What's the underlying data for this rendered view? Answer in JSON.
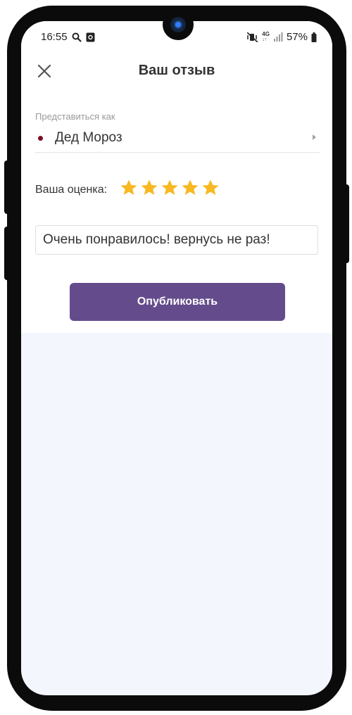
{
  "status_bar": {
    "time": "16:55",
    "network": "4G",
    "battery": "57%"
  },
  "header": {
    "title": "Ваш отзыв",
    "close_icon": "close-icon"
  },
  "form": {
    "post_as_label": "Представиться как",
    "post_as_value": "Дед Мороз",
    "rating_label": "Ваша оценка:",
    "rating": 5,
    "rating_max": 5,
    "star_color": "#f7b821",
    "review_text": "Очень понравилось! вернусь не раз!",
    "publish_label": "Опубликовать",
    "publish_color": "#644c8c"
  }
}
